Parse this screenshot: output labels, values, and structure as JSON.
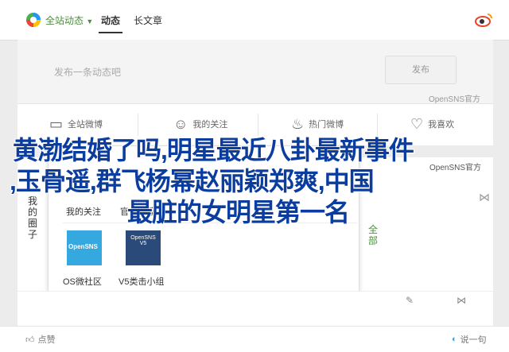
{
  "topbar": {
    "filter_label": "全站动态",
    "tab_active": "动态",
    "tab_article": "长文章"
  },
  "composer": {
    "placeholder": "发布一条动态吧",
    "publish_label": "发布"
  },
  "credit": "OpenSNS官方",
  "actions": {
    "weibo": "全站微博",
    "follow": "我的关注",
    "hot": "热门微博",
    "like": "我喜欢"
  },
  "card": {
    "vertical_left": [
      "我",
      "的",
      "圈",
      "子"
    ],
    "vertical_right": [
      "全",
      "部"
    ],
    "credit2": "OpenSNS官方"
  },
  "popup": {
    "tab_follow": "我的关注",
    "tab_recommend": "官方推荐",
    "items": [
      {
        "caption": "OS微社区",
        "thumb_text": "OpenSNS",
        "color": "#35a8e0"
      },
      {
        "caption": "V5类击小组",
        "thumb_text": "OpenSNS V5",
        "color": "#2a4a7a"
      }
    ]
  },
  "footer": {
    "like_label": "点赞",
    "comment_label": "说一句"
  },
  "overlay": {
    "line1": "黄渤结婚了吗,明星最近八卦最新事件",
    "line2": ",玉骨遥,群飞杨幂赵丽颖郑爽,中国",
    "line3": "最脏的女明星第一名"
  },
  "colors": {
    "accent": "#0b3d9e",
    "brand": "#e8452c"
  }
}
